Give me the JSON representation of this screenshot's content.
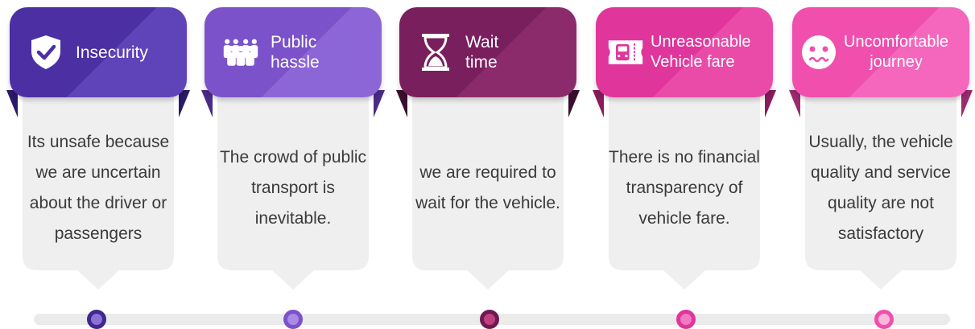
{
  "steps": [
    {
      "title": "Insecurity",
      "icon": "shield-check-icon",
      "color": "#4b2fa3",
      "color_light": "#5f43b8",
      "dot_border": "#3d2a8c",
      "dot_fill": "#8d6fd6",
      "text": "Its unsafe because we are uncertain about the driver or passengers"
    },
    {
      "title": "Public\nhassle",
      "icon": "people-crowd-icon",
      "color": "#7b52c9",
      "color_light": "#8c66d6",
      "dot_border": "#7b52c9",
      "dot_fill": "#a98be6",
      "text": "The crowd of public transport is inevitable."
    },
    {
      "title": "Wait\ntime",
      "icon": "hourglass-icon",
      "color": "#7a1f5e",
      "color_light": "#8c2b6c",
      "dot_border": "#6d1a52",
      "dot_fill": "#c0407e",
      "text": "we are required to wait for the vehicle."
    },
    {
      "title": "Unreasonable\nVehicle fare",
      "icon": "bus-ticket-icon",
      "color": "#e0359b",
      "color_light": "#ea4aa8",
      "dot_border": "#e0359b",
      "dot_fill": "#f07bc0",
      "text": "There is no financial transparency of vehicle fare."
    },
    {
      "title": "Uncomfortable\njourney",
      "icon": "uncomfortable-face-icon",
      "color": "#f04fae",
      "color_light": "#f566bd",
      "dot_border": "#f04fae",
      "dot_fill": "#f9b7dc",
      "text": "Usually, the vehicle quality and service quality are not satisfactory"
    }
  ]
}
